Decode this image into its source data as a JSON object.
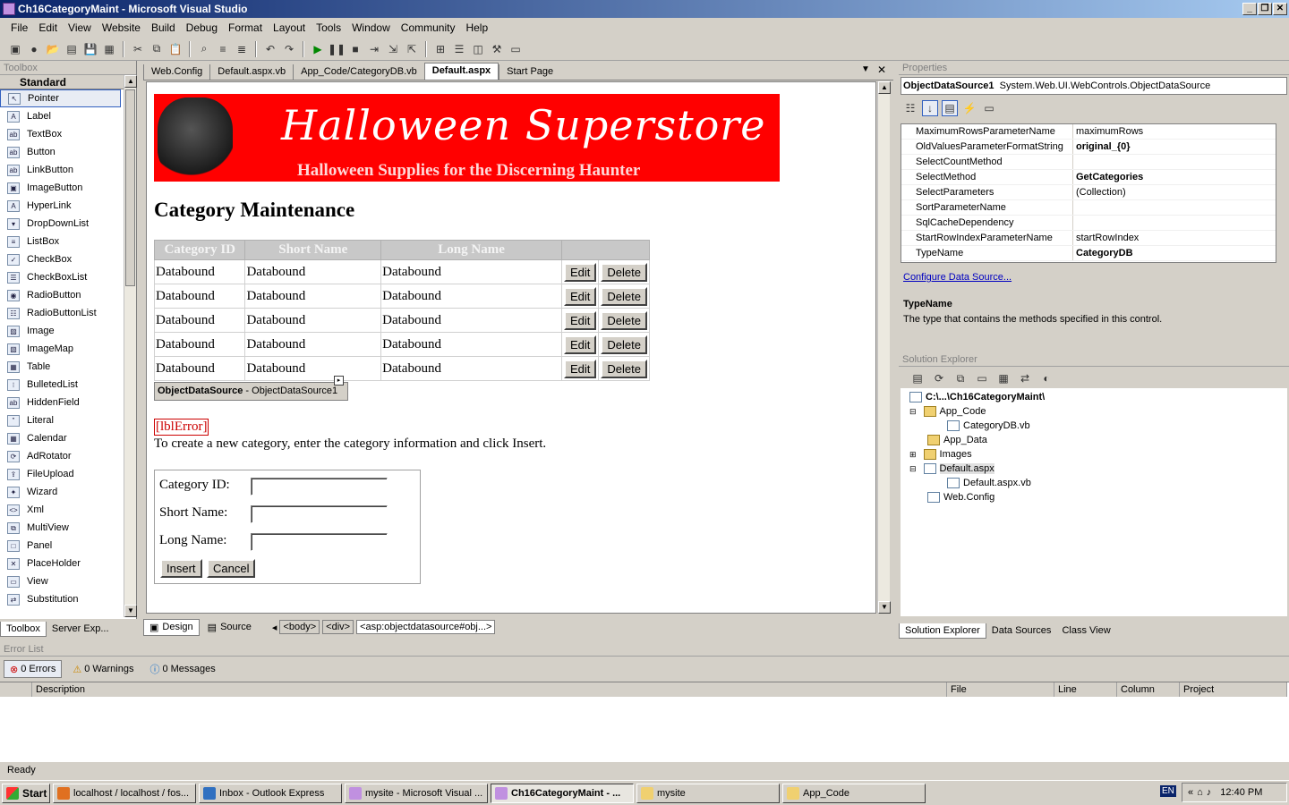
{
  "window": {
    "title": "Ch16CategoryMaint - Microsoft Visual Studio"
  },
  "menu": [
    "File",
    "Edit",
    "View",
    "Website",
    "Build",
    "Debug",
    "Format",
    "Layout",
    "Tools",
    "Window",
    "Community",
    "Help"
  ],
  "toolbox": {
    "title": "Toolbox",
    "group": "Standard",
    "items": [
      "Pointer",
      "Label",
      "TextBox",
      "Button",
      "LinkButton",
      "ImageButton",
      "HyperLink",
      "DropDownList",
      "ListBox",
      "CheckBox",
      "CheckBoxList",
      "RadioButton",
      "RadioButtonList",
      "Image",
      "ImageMap",
      "Table",
      "BulletedList",
      "HiddenField",
      "Literal",
      "Calendar",
      "AdRotator",
      "FileUpload",
      "Wizard",
      "Xml",
      "MultiView",
      "Panel",
      "PlaceHolder",
      "View",
      "Substitution"
    ],
    "tab_toolbox": "Toolbox",
    "tab_server": "Server Exp..."
  },
  "doc_tabs": [
    "Web.Config",
    "Default.aspx.vb",
    "App_Code/CategoryDB.vb",
    "Default.aspx",
    "Start Page"
  ],
  "page": {
    "banner_title": "Halloween Superstore",
    "banner_sub": "Halloween Supplies for the Discerning Haunter",
    "heading": "Category Maintenance",
    "grid_headers": [
      "Category ID",
      "Short Name",
      "Long Name"
    ],
    "grid_rows": [
      [
        "Databound",
        "Databound",
        "Databound"
      ],
      [
        "Databound",
        "Databound",
        "Databound"
      ],
      [
        "Databound",
        "Databound",
        "Databound"
      ],
      [
        "Databound",
        "Databound",
        "Databound"
      ],
      [
        "Databound",
        "Databound",
        "Databound"
      ]
    ],
    "edit_label": "Edit",
    "delete_label": "Delete",
    "ods_type": "ObjectDataSource",
    "ods_id": " - ObjectDataSource1",
    "lbl_error": "[lblError]",
    "instructions": "To create a new category, enter the category information and click Insert.",
    "form_labels": [
      "Category ID:",
      "Short Name:",
      "Long Name:"
    ],
    "insert_label": "Insert",
    "cancel_label": "Cancel"
  },
  "design_bar": {
    "design": "Design",
    "source": "Source",
    "crumbs": [
      "<body>",
      "<div>",
      "<asp:objectdatasource#obj...>"
    ]
  },
  "properties": {
    "title": "Properties",
    "object": "ObjectDataSource1",
    "object_type": "System.Web.UI.WebControls.ObjectDataSource",
    "rows": [
      {
        "name": "MaximumRowsParameterName",
        "value": "maximumRows",
        "bold": false
      },
      {
        "name": "OldValuesParameterFormatString",
        "value": "original_{0}",
        "bold": true
      },
      {
        "name": "SelectCountMethod",
        "value": "",
        "bold": false
      },
      {
        "name": "SelectMethod",
        "value": "GetCategories",
        "bold": true
      },
      {
        "name": "SelectParameters",
        "value": "(Collection)",
        "bold": false
      },
      {
        "name": "SortParameterName",
        "value": "",
        "bold": false
      },
      {
        "name": "SqlCacheDependency",
        "value": "",
        "bold": false
      },
      {
        "name": "StartRowIndexParameterName",
        "value": "startRowIndex",
        "bold": false
      },
      {
        "name": "TypeName",
        "value": "CategoryDB",
        "bold": true
      }
    ],
    "configure_link": "Configure Data Source...",
    "desc_title": "TypeName",
    "desc_text": "The type that contains the methods specified in this control."
  },
  "solution": {
    "title": "Solution Explorer",
    "root": "C:\\...\\Ch16CategoryMaint\\",
    "nodes": [
      "App_Code",
      "CategoryDB.vb",
      "App_Data",
      "Images",
      "Default.aspx",
      "Default.aspx.vb",
      "Web.Config"
    ],
    "tabs": [
      "Solution Explorer",
      "Data Sources",
      "Class View"
    ]
  },
  "errorlist": {
    "title": "Error List",
    "errors": "0 Errors",
    "warnings": "0 Warnings",
    "messages": "0 Messages",
    "columns": [
      "Description",
      "File",
      "Line",
      "Column",
      "Project"
    ]
  },
  "status": "Ready",
  "taskbar": {
    "start": "Start",
    "items": [
      "localhost / localhost / fos...",
      "Inbox - Outlook Express",
      "mysite - Microsoft Visual ...",
      "Ch16CategoryMaint - ...",
      "mysite",
      "App_Code"
    ],
    "lang": "EN",
    "clock": "12:40 PM"
  }
}
